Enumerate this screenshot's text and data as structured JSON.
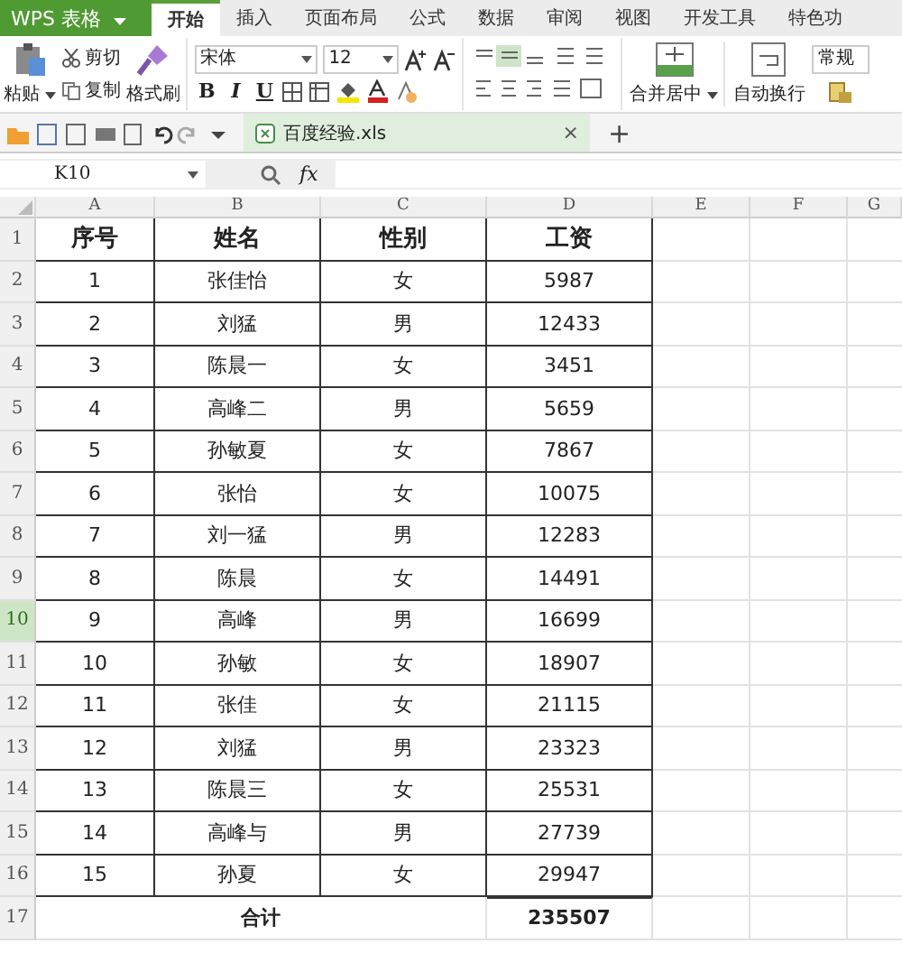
{
  "app_menu": {
    "label": "WPS 表格"
  },
  "tabs": [
    {
      "label": "开始",
      "selected": true
    },
    {
      "label": "插入",
      "selected": false
    },
    {
      "label": "页面布局",
      "selected": false
    },
    {
      "label": "公式",
      "selected": false
    },
    {
      "label": "数据",
      "selected": false
    },
    {
      "label": "审阅",
      "selected": false
    },
    {
      "label": "视图",
      "selected": false
    },
    {
      "label": "开发工具",
      "selected": false
    },
    {
      "label": "特色功",
      "selected": false
    }
  ],
  "ribbon": {
    "paste": "粘贴",
    "cut": "剪切",
    "copy": "复制",
    "format_painter": "格式刷",
    "font_name": "宋体",
    "font_size": "12",
    "font_styles": [
      "B",
      "I",
      "U"
    ],
    "merge": "合并居中",
    "wrap": "自动换行",
    "number_format": "常规"
  },
  "doc_tab": {
    "title": "百度经验.xls",
    "close": "×",
    "new": "+"
  },
  "formula_bar": {
    "name_box": "K10",
    "fx": "fx"
  },
  "sheet": {
    "columns": [
      "A",
      "B",
      "C",
      "D",
      "E",
      "F",
      "G"
    ],
    "rows": [
      {
        "header": "1",
        "kind": "heading",
        "selected": false,
        "cells": [
          "序号",
          "姓名",
          "性别",
          "工资"
        ]
      },
      {
        "header": "2",
        "kind": "data",
        "selected": false,
        "cells": [
          "1",
          "张佳怡",
          "女",
          "5987"
        ]
      },
      {
        "header": "3",
        "kind": "data",
        "selected": false,
        "cells": [
          "2",
          "刘猛",
          "男",
          "12433"
        ]
      },
      {
        "header": "4",
        "kind": "data",
        "selected": false,
        "cells": [
          "3",
          "陈晨一",
          "女",
          "3451"
        ]
      },
      {
        "header": "5",
        "kind": "data",
        "selected": false,
        "cells": [
          "4",
          "高峰二",
          "男",
          "5659"
        ]
      },
      {
        "header": "6",
        "kind": "data",
        "selected": false,
        "cells": [
          "5",
          "孙敏夏",
          "女",
          "7867"
        ]
      },
      {
        "header": "7",
        "kind": "data",
        "selected": false,
        "cells": [
          "6",
          "张怡",
          "女",
          "10075"
        ]
      },
      {
        "header": "8",
        "kind": "data",
        "selected": false,
        "cells": [
          "7",
          "刘一猛",
          "男",
          "12283"
        ]
      },
      {
        "header": "9",
        "kind": "data",
        "selected": false,
        "cells": [
          "8",
          "陈晨",
          "女",
          "14491"
        ]
      },
      {
        "header": "10",
        "kind": "data",
        "selected": true,
        "cells": [
          "9",
          "高峰",
          "男",
          "16699"
        ]
      },
      {
        "header": "11",
        "kind": "data",
        "selected": false,
        "cells": [
          "10",
          "孙敏",
          "女",
          "18907"
        ]
      },
      {
        "header": "12",
        "kind": "data",
        "selected": false,
        "cells": [
          "11",
          "张佳",
          "女",
          "21115"
        ]
      },
      {
        "header": "13",
        "kind": "data",
        "selected": false,
        "cells": [
          "12",
          "刘猛",
          "男",
          "23323"
        ]
      },
      {
        "header": "14",
        "kind": "data",
        "selected": false,
        "cells": [
          "13",
          "陈晨三",
          "女",
          "25531"
        ]
      },
      {
        "header": "15",
        "kind": "data",
        "selected": false,
        "cells": [
          "14",
          "高峰与",
          "男",
          "27739"
        ]
      },
      {
        "header": "16",
        "kind": "data",
        "selected": false,
        "cells": [
          "15",
          "孙夏",
          "女",
          "29947"
        ]
      },
      {
        "header": "17",
        "kind": "total",
        "selected": false,
        "label": "合计",
        "value": "235507"
      }
    ]
  }
}
